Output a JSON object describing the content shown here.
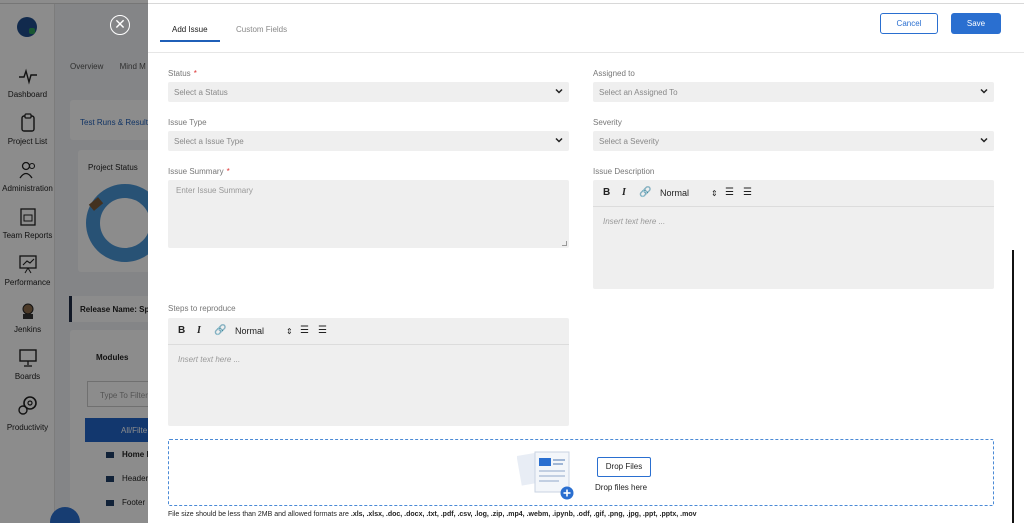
{
  "sidebar": {
    "items": [
      {
        "label": "Dashboard",
        "icon": "pulse-icon"
      },
      {
        "label": "Project List",
        "icon": "clipboard-icon"
      },
      {
        "label": "Administration",
        "icon": "users-icon"
      },
      {
        "label": "Team Reports",
        "icon": "report-icon"
      },
      {
        "label": "Performance",
        "icon": "chart-board-icon"
      },
      {
        "label": "Jenkins",
        "icon": "jenkins-icon"
      },
      {
        "label": "Boards",
        "icon": "monitor-icon"
      },
      {
        "label": "Productivity",
        "icon": "gears-icon"
      }
    ]
  },
  "background": {
    "tabs": [
      "Overview",
      "Mind M"
    ],
    "link": "Test Runs & Result",
    "project_status": "Project Status",
    "release_name": "Release Name: Spr",
    "modules": "Modules",
    "filter_placeholder": "Type To Filter",
    "module_items": [
      "All/Filte",
      "Home I",
      "Header",
      "Footer"
    ]
  },
  "drawer": {
    "tabs": [
      "Add Issue",
      "Custom Fields"
    ],
    "cancel_label": "Cancel",
    "save_label": "Save",
    "fields": {
      "status": {
        "label": "Status",
        "required": "*",
        "placeholder": "Select a Status"
      },
      "assigned_to": {
        "label": "Assigned to",
        "placeholder": "Select an Assigned To"
      },
      "issue_type": {
        "label": "Issue Type",
        "placeholder": "Select a Issue Type"
      },
      "severity": {
        "label": "Severity",
        "placeholder": "Select a Severity"
      },
      "issue_summary": {
        "label": "Issue Summary",
        "required": "*",
        "placeholder": "Enter Issue Summary"
      },
      "issue_description": {
        "label": "Issue Description",
        "placeholder": "Insert text here ..."
      },
      "steps": {
        "label": "Steps to reproduce",
        "placeholder": "Insert text here ..."
      }
    },
    "editor_toolbar": {
      "bold": "B",
      "italic": "I",
      "format": "Normal"
    },
    "drop": {
      "button": "Drop Files",
      "hint": "Drop files here",
      "note_prefix": "File size should be less than 2MB and allowed formats are ",
      "formats": ".xls, .xlsx, .doc, .docx, .txt, .pdf, .csv, .log, .zip, .mp4, .webm, .ipynb, .odf, .gif, .png, .jpg, .ppt, .pptx, .mov"
    }
  },
  "colors": {
    "accent": "#2a6fd0",
    "required": "#d33333",
    "field_bg": "#efefef"
  }
}
